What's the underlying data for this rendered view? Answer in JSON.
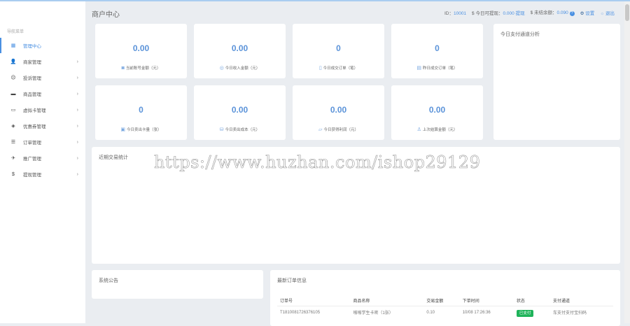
{
  "header": {
    "title": "商户中心",
    "id_label": "ID：",
    "id_value": "10001",
    "withdrawable_label": "$ 今日可提现：",
    "withdrawable_value": "0.000",
    "withdraw_link": "提现",
    "unsettled_label": "$ 未结余额：",
    "unsettled_value": "0.090",
    "help": "?",
    "settings": "设置",
    "logout": "退出"
  },
  "sidebar": {
    "title": "导航菜单",
    "items": [
      {
        "label": "管理中心",
        "icon": "dashboard-icon",
        "glyph": "▦"
      },
      {
        "label": "商家管理",
        "icon": "user-icon",
        "glyph": "👤"
      },
      {
        "label": "投诉管理",
        "icon": "complaint-icon",
        "glyph": "☹"
      },
      {
        "label": "商品管理",
        "icon": "goods-icon",
        "glyph": "▬"
      },
      {
        "label": "虚拟卡管理",
        "icon": "card-icon",
        "glyph": "▭"
      },
      {
        "label": "优惠券管理",
        "icon": "coupon-icon",
        "glyph": "◈"
      },
      {
        "label": "订单管理",
        "icon": "order-icon",
        "glyph": "☰"
      },
      {
        "label": "推广管理",
        "icon": "promote-icon",
        "glyph": "✈"
      },
      {
        "label": "提现管理",
        "icon": "dollar-icon",
        "glyph": "$"
      }
    ]
  },
  "stats": [
    {
      "value": "0.00",
      "label": "当前账号金额（元）"
    },
    {
      "value": "0.00",
      "label": "今日收入金额（元）"
    },
    {
      "value": "0",
      "label": "今日成交订单（笔）"
    },
    {
      "value": "0",
      "label": "昨日成交订单（笔）"
    },
    {
      "value": "0",
      "label": "今日卖出卡量（张）"
    },
    {
      "value": "0.00",
      "label": "今日卖出成本（元）"
    },
    {
      "value": "0.00",
      "label": "今日获得利润（元）"
    },
    {
      "value": "0.00",
      "label": "上次结算金额（元）"
    }
  ],
  "panels": {
    "channel_analysis": "今日支付通道分析",
    "recent_stats": "近期交易统计",
    "notice": "系统公告",
    "latest_orders": "最新订单信息"
  },
  "orders": {
    "columns": [
      "订单号",
      "商品名称",
      "交易金额",
      "下单时间",
      "状态",
      "支付通道"
    ],
    "rows": [
      {
        "id": "T1810081726376105",
        "product": "啪啪学生卡密（1张）",
        "amount": "0.10",
        "time": "10/08 17:26:36",
        "status": "已支付",
        "channel": "车支付支付宝扫码"
      }
    ]
  },
  "watermark": "https://www.huzhan.com/ishop29129"
}
